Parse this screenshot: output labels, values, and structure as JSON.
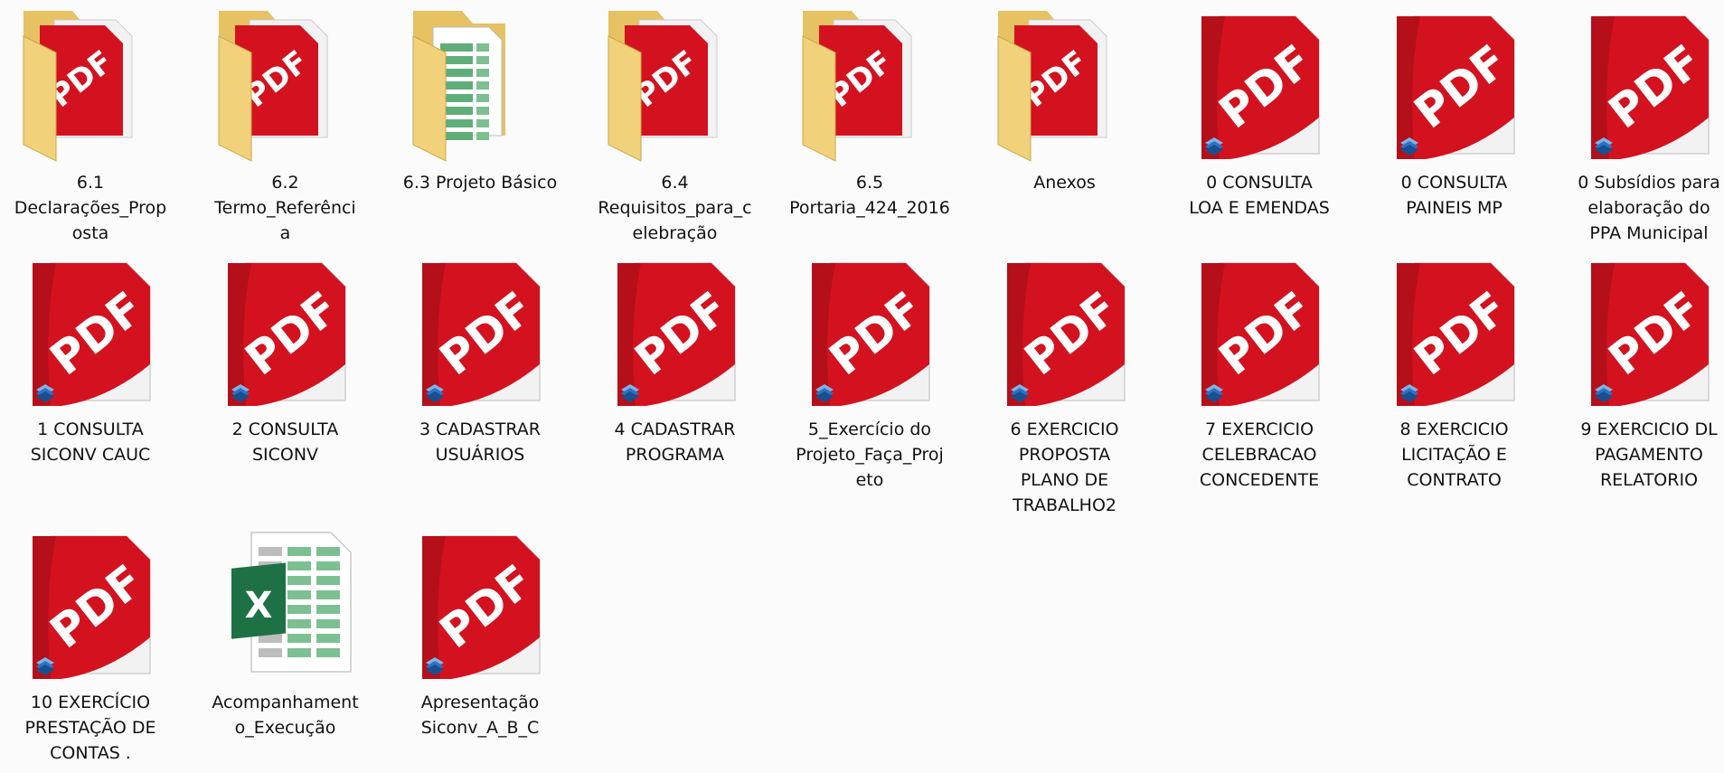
{
  "items": [
    {
      "label": "6.1\nDeclarações_Prop\nosta",
      "type": "folder",
      "preview": "pdf",
      "icon": "folder-icon"
    },
    {
      "label": "6.2\nTermo_Referênci\na",
      "type": "folder",
      "preview": "pdf",
      "icon": "folder-icon"
    },
    {
      "label": "6.3 Projeto Básico",
      "type": "folder",
      "preview": "sheet",
      "icon": "folder-icon"
    },
    {
      "label": "6.4\nRequisitos_para_c\nelebração",
      "type": "folder",
      "preview": "pdf",
      "icon": "folder-icon"
    },
    {
      "label": "6.5\nPortaria_424_2016",
      "type": "folder",
      "preview": "pdf",
      "icon": "folder-icon"
    },
    {
      "label": "Anexos",
      "type": "folder",
      "preview": "pdf",
      "icon": "folder-icon"
    },
    {
      "label": "0 CONSULTA\nLOA E EMENDAS",
      "type": "pdf",
      "icon": "pdf-file-icon"
    },
    {
      "label": "0 CONSULTA\nPAINEIS MP",
      "type": "pdf",
      "icon": "pdf-file-icon"
    },
    {
      "label": "0 Subsídios para\nelaboração do\nPPA Municipal",
      "type": "pdf",
      "icon": "pdf-file-icon"
    },
    {
      "label": "1 CONSULTA\nSICONV CAUC",
      "type": "pdf",
      "icon": "pdf-file-icon"
    },
    {
      "label": "2 CONSULTA\nSICONV",
      "type": "pdf",
      "icon": "pdf-file-icon"
    },
    {
      "label": "3 CADASTRAR\nUSUÁRIOS",
      "type": "pdf",
      "icon": "pdf-file-icon"
    },
    {
      "label": "4 CADASTRAR\nPROGRAMA",
      "type": "pdf",
      "icon": "pdf-file-icon"
    },
    {
      "label": "5_Exercício do\nProjeto_Faça_Proj\neto",
      "type": "pdf",
      "icon": "pdf-file-icon"
    },
    {
      "label": "6 EXERCICIO\nPROPOSTA\nPLANO DE\nTRABALHO2",
      "type": "pdf",
      "icon": "pdf-file-icon"
    },
    {
      "label": "7 EXERCICIO\nCELEBRACAO\nCONCEDENTE",
      "type": "pdf",
      "icon": "pdf-file-icon"
    },
    {
      "label": "8 EXERCICIO\nLICITAÇÃO E\nCONTRATO",
      "type": "pdf",
      "icon": "pdf-file-icon"
    },
    {
      "label": "9 EXERCICIO DL\nPAGAMENTO\nRELATORIO",
      "type": "pdf",
      "icon": "pdf-file-icon"
    },
    {
      "label": "10 EXERCÍCIO\nPRESTAÇÃO DE\nCONTAS .",
      "type": "pdf",
      "icon": "pdf-file-icon"
    },
    {
      "label": "Acompanhament\no_Execução",
      "type": "excel",
      "icon": "excel-file-icon"
    },
    {
      "label": "Apresentação\nSiconv_A_B_C",
      "type": "pdf",
      "icon": "pdf-file-icon"
    }
  ],
  "badges": {
    "pdf": "PDF",
    "excel": "X"
  },
  "colors": {
    "pdf_red": "#d4121f",
    "pdf_dark_red": "#9b0d15",
    "folder_yellow": "#f1d27a",
    "excel_green": "#1e7145",
    "badge_blue": "#2a72c4"
  }
}
